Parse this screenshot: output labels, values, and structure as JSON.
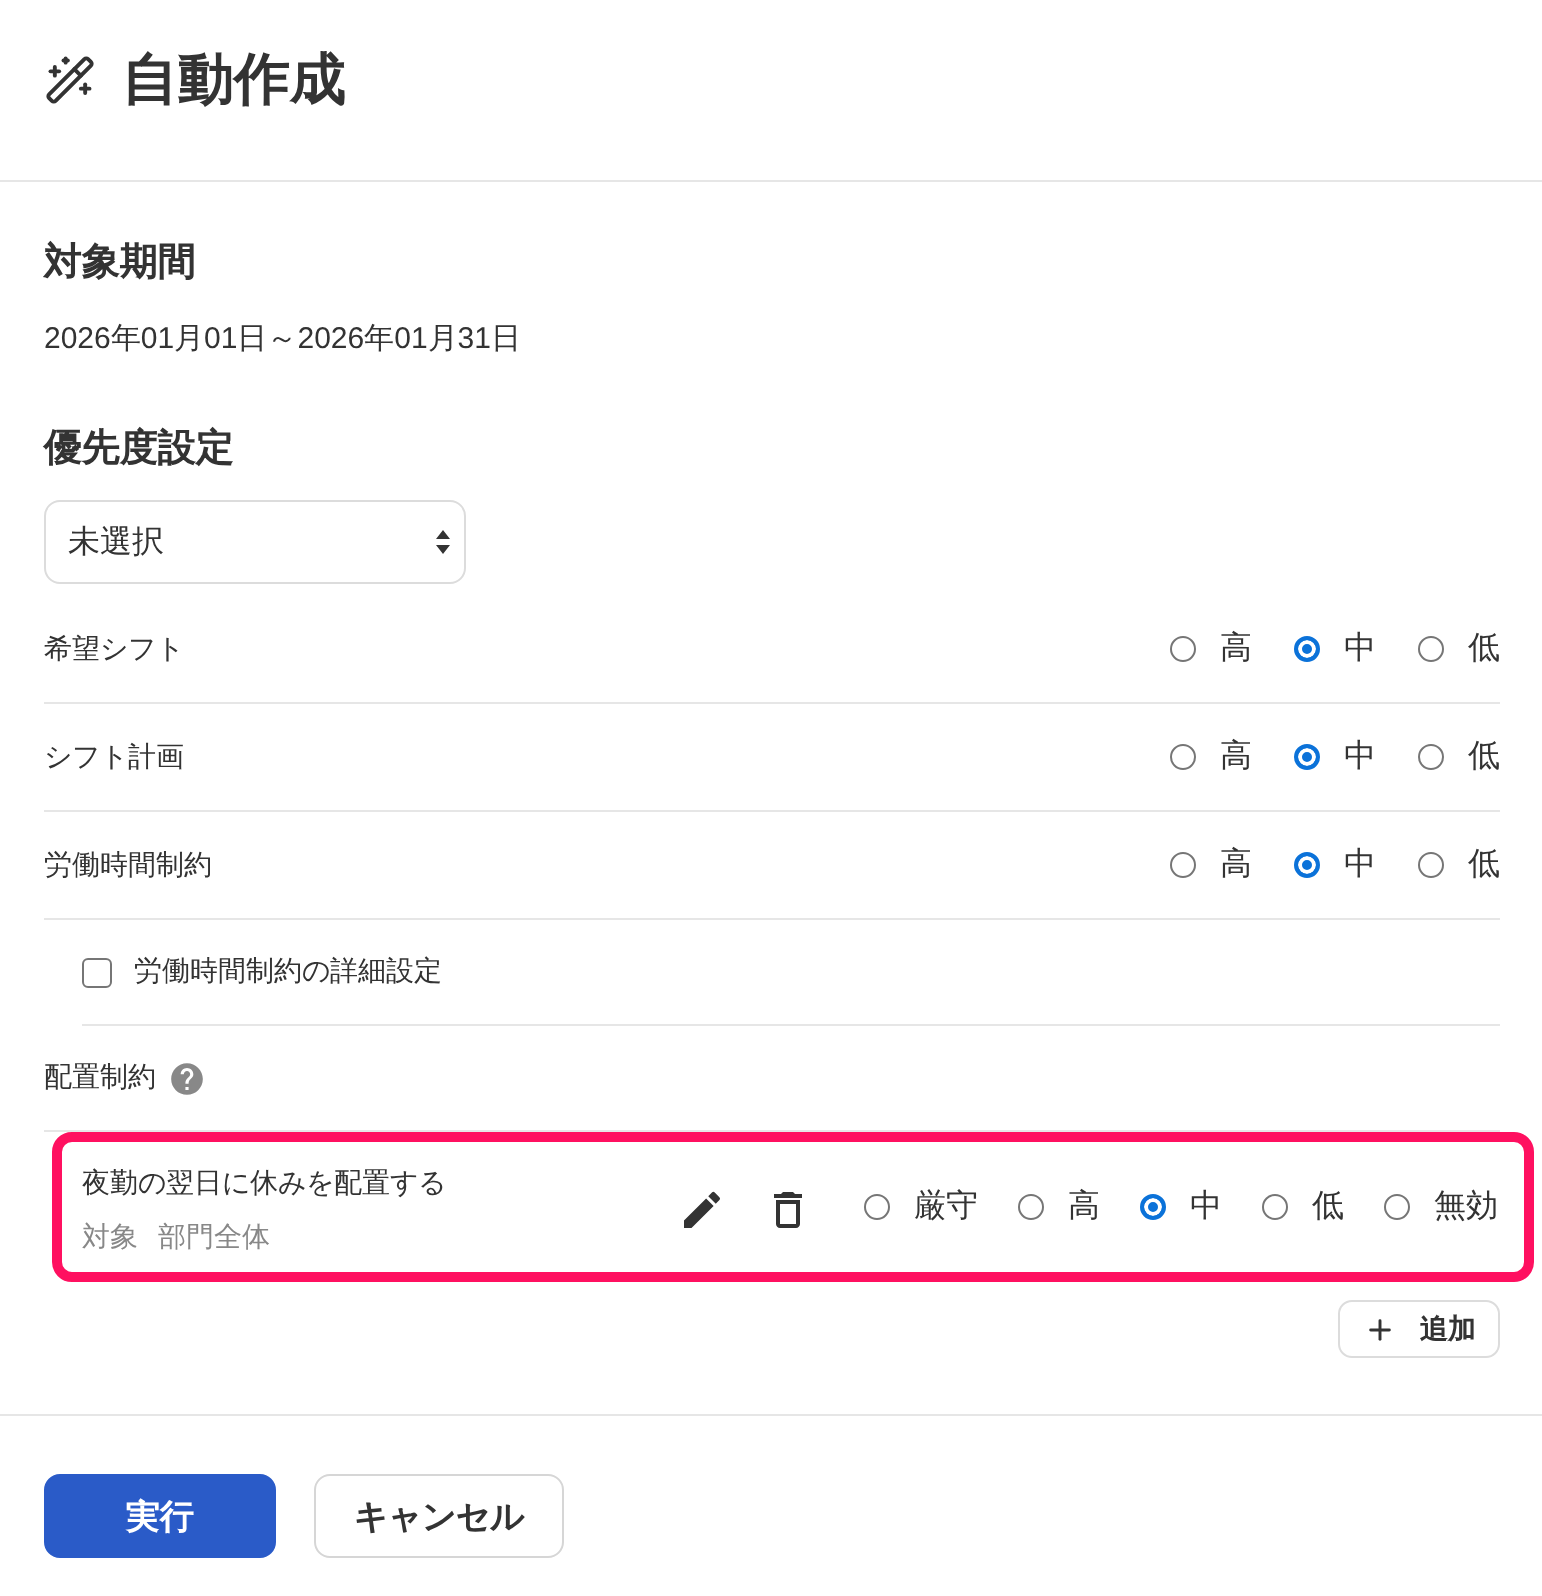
{
  "header": {
    "title": "自動作成"
  },
  "period": {
    "heading": "対象期間",
    "value": "2026年01月01日～2026年01月31日"
  },
  "priority": {
    "heading": "優先度設定",
    "select": {
      "value": "未選択"
    },
    "rows": [
      {
        "label": "希望シフト",
        "options": [
          {
            "label": "高",
            "selected": false
          },
          {
            "label": "中",
            "selected": true
          },
          {
            "label": "低",
            "selected": false
          }
        ]
      },
      {
        "label": "シフト計画",
        "options": [
          {
            "label": "高",
            "selected": false
          },
          {
            "label": "中",
            "selected": true
          },
          {
            "label": "低",
            "selected": false
          }
        ]
      },
      {
        "label": "労働時間制約",
        "options": [
          {
            "label": "高",
            "selected": false
          },
          {
            "label": "中",
            "selected": true
          },
          {
            "label": "低",
            "selected": false
          }
        ]
      }
    ],
    "detail_setting": {
      "label": "労働時間制約の詳細設定",
      "checked": false
    }
  },
  "placement": {
    "heading": "配置制約",
    "constraints": [
      {
        "title": "夜勤の翌日に休みを配置する",
        "target_label": "対象",
        "target_value": "部門全体",
        "highlighted": true,
        "options": [
          {
            "label": "厳守",
            "selected": false
          },
          {
            "label": "高",
            "selected": false
          },
          {
            "label": "中",
            "selected": true
          },
          {
            "label": "低",
            "selected": false
          },
          {
            "label": "無効",
            "selected": false
          }
        ]
      }
    ],
    "add_button": {
      "label": "追加"
    }
  },
  "footer": {
    "buttons": [
      {
        "label": "実行",
        "kind": "primary"
      },
      {
        "label": "キャンセル",
        "kind": "secondary"
      }
    ]
  }
}
